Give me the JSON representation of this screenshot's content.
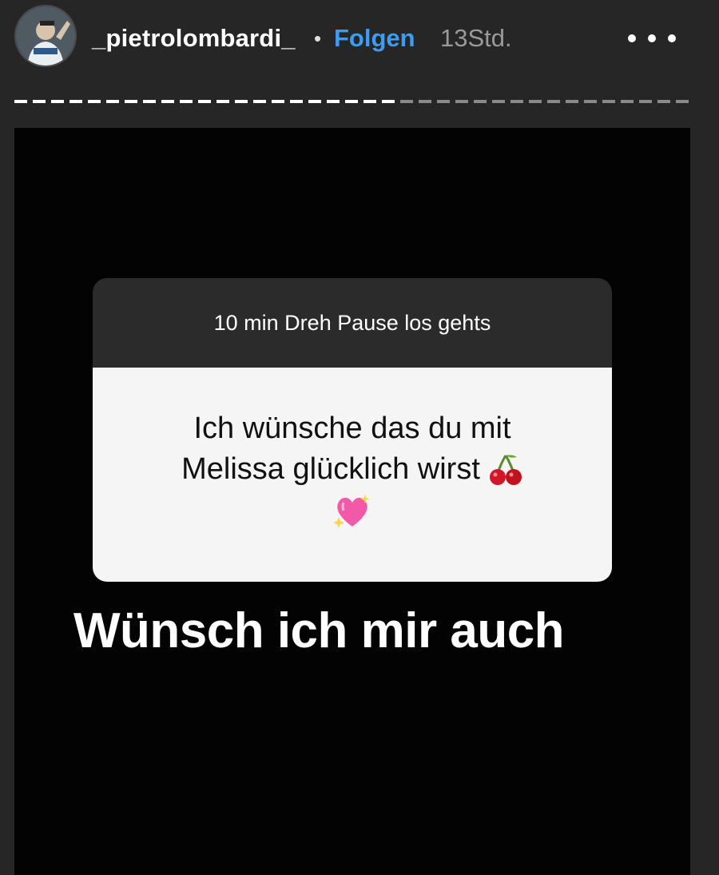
{
  "header": {
    "username": "_pietrolombardi_",
    "separator": "•",
    "follow_label": "Folgen",
    "time": "13Std.",
    "avatar_icon": "profile-photo-icon",
    "more_icon": "more-options-icon"
  },
  "progress": {
    "segments": 2,
    "current_segment_progress": 0.55,
    "completed_color": "#ffffff",
    "remaining_color": "#8a8a8a"
  },
  "story": {
    "question_sticker": {
      "title": "10 min Dreh Pause los gehts",
      "answer_line1": "Ich wünsche das du mit",
      "answer_line2": "Melissa glücklich wirst",
      "emoji_1": "cherries-icon",
      "emoji_2": "sparkling-heart-icon"
    },
    "reply_text": "Wünsch ich mir auch"
  },
  "colors": {
    "background": "#262626",
    "story_background": "#030303",
    "follow_blue": "#3e9cf0",
    "sticker_header": "#2b2b2b",
    "sticker_body": "#f5f5f5"
  }
}
